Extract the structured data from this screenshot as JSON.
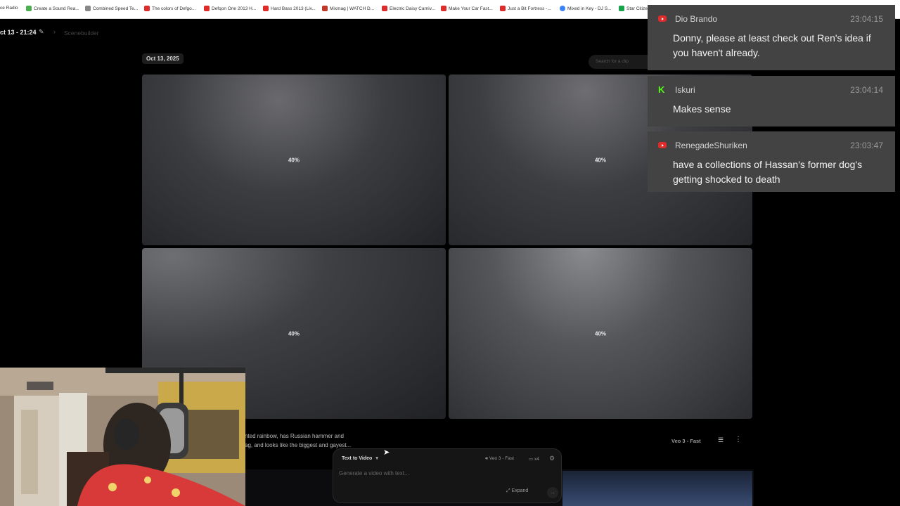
{
  "bookmarks": [
    {
      "label": "ce Radio",
      "color": "#999999"
    },
    {
      "label": "Create a Sound Rea...",
      "color": "#4caf50"
    },
    {
      "label": "Combined Speed Te...",
      "color": "#888888"
    },
    {
      "label": "The colors of Defgo...",
      "color": "#e02b2b"
    },
    {
      "label": "Defqon One 2013 H...",
      "color": "#e02b2b"
    },
    {
      "label": "Hard Bass 2013 (Liv...",
      "color": "#e02b2b"
    },
    {
      "label": "Mixmag | WATCH D...",
      "color": "#c0392b"
    },
    {
      "label": "Electric Daisy Carniv...",
      "color": "#e02b2b"
    },
    {
      "label": "Make Your Car Fast...",
      "color": "#e02b2b"
    },
    {
      "label": "Just a Bit Fortress -...",
      "color": "#e02b2b"
    },
    {
      "label": "Mixed in Key - DJ S...",
      "color": "#3b82f6"
    },
    {
      "label": "Star Citize",
      "color": "#16a34a"
    }
  ],
  "header": {
    "title": "ct 13 - 21:24",
    "breadcrumb": "Scenebuilder"
  },
  "gallery": {
    "date": "Oct 13, 2025",
    "search_placeholder": "Search for a clip",
    "tiles": [
      {
        "progress": "40%"
      },
      {
        "progress": "40%"
      },
      {
        "progress": "40%"
      },
      {
        "progress": "40%"
      }
    ],
    "prompt_line1": "nted rainbow, has Russian hammer and",
    "prompt_line2": "ag, and looks like the biggest and gayest...",
    "model": "Veo 3 - Fast"
  },
  "generator": {
    "mode": "Text to Video",
    "model": "Veo 3 - Fast",
    "count": "x4",
    "placeholder": "Generate a video with text...",
    "expand": "Expand"
  },
  "chat": [
    {
      "platform": "youtube",
      "name": "Dio Brando",
      "time": "23:04:15",
      "message": "Donny, please at least check out Ren's idea if you haven't already."
    },
    {
      "platform": "kick",
      "name": "Iskuri",
      "time": "23:04:14",
      "message": "Makes sense"
    },
    {
      "platform": "youtube",
      "name": "RenegadeShuriken",
      "time": "23:03:47",
      "message": "have a collections of Hassan's former dog's getting shocked to death"
    }
  ],
  "colors": {
    "youtube": "#e02b2b",
    "kick": "#53fc18",
    "chat_bg": "#434343"
  }
}
